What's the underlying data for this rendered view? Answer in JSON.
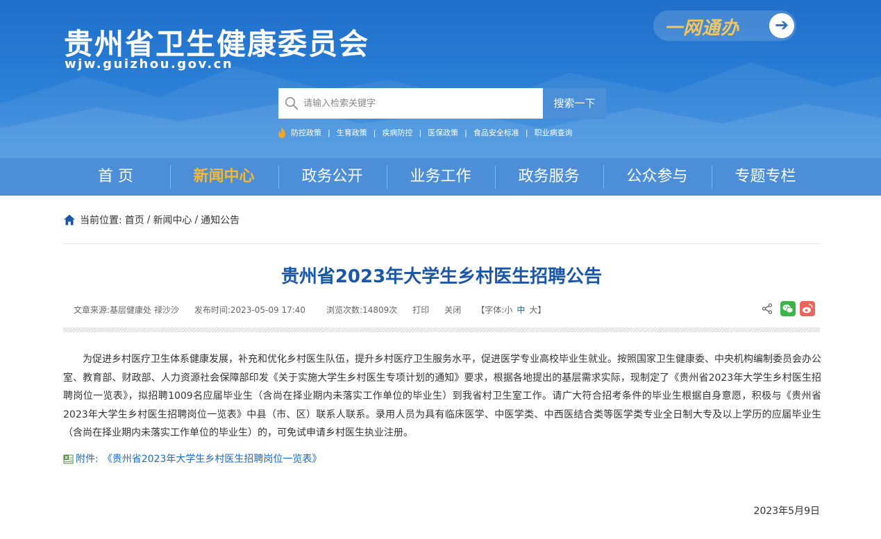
{
  "header": {
    "site_title": "贵州省卫生健康委员会",
    "site_domain": "wjw.guizhou.gov.cn",
    "yiwang_label": "一网通办",
    "yiwang_arrow": "➔"
  },
  "search": {
    "placeholder": "请输入检索关键字",
    "button_label": "搜索一下"
  },
  "hot_links": [
    "防控政策",
    "生育政策",
    "疾病防控",
    "医保政策",
    "食品安全标准",
    "职业病查询"
  ],
  "hot_separator": "|",
  "nav": {
    "items": [
      "首 页",
      "新闻中心",
      "政务公开",
      "业务工作",
      "政务服务",
      "公众参与",
      "专题专栏"
    ],
    "active_index": 1
  },
  "breadcrumb": {
    "prefix": "当前位置:",
    "items": [
      "首页",
      "新闻中心",
      "通知公告"
    ],
    "separator": "/"
  },
  "article": {
    "title": "贵州省2023年大学生乡村医生招聘公告",
    "meta": {
      "source": "文章来源:基层健康处 禄沙沙",
      "published": "发布时间:2023-05-09 17:40",
      "views": "浏览次数:14809次",
      "print": "打印",
      "close": "关闭",
      "font_size_prefix": "【字体:",
      "font_small": "小",
      "font_medium": "中",
      "font_large": "大",
      "font_size_suffix": "】"
    },
    "body": "为促进乡村医疗卫生体系健康发展，补充和优化乡村医生队伍，提升乡村医疗卫生服务水平，促进医学专业高校毕业生就业。按照国家卫生健康委、中央机构编制委员会办公室、教育部、财政部、人力资源社会保障部印发《关于实施大学生乡村医生专项计划的通知》要求，根据各地提出的基层需求实际，现制定了《贵州省2023年大学生乡村医生招聘岗位一览表》，拟招聘1009名应届毕业生（含尚在择业期内未落实工作单位的毕业生）到我省村卫生室工作。请广大符合招考条件的毕业生根据自身意愿，积极与《贵州省2023年大学生乡村医生招聘岗位一览表》中县（市、区）联系人联系。录用人员为具有临床医学、中医学类、中西医结合类等医学类专业全日制大专及以上学历的应届毕业生（含尚在择业期内未落实工作单位的毕业生）的，可免试申请乡村医生执业注册。",
    "attachment_label": "附件:",
    "attachment_link": "《贵州省2023年大学生乡村医生招聘岗位一览表》",
    "date": "2023年5月9日"
  },
  "colors": {
    "header_blue": "#2a7fd6",
    "nav_blue": "#4c8fd8",
    "nav_active": "#f7b733",
    "title_blue": "#1a57a8",
    "link_blue": "#1a6bc7",
    "wechat_green": "#3bb54a",
    "weibo_red": "#e8665c"
  },
  "icons": [
    "search-icon",
    "fire-icon",
    "home-icon",
    "share-icon",
    "wechat-icon",
    "weibo-icon",
    "excel-file-icon",
    "arrow-right-icon"
  ]
}
